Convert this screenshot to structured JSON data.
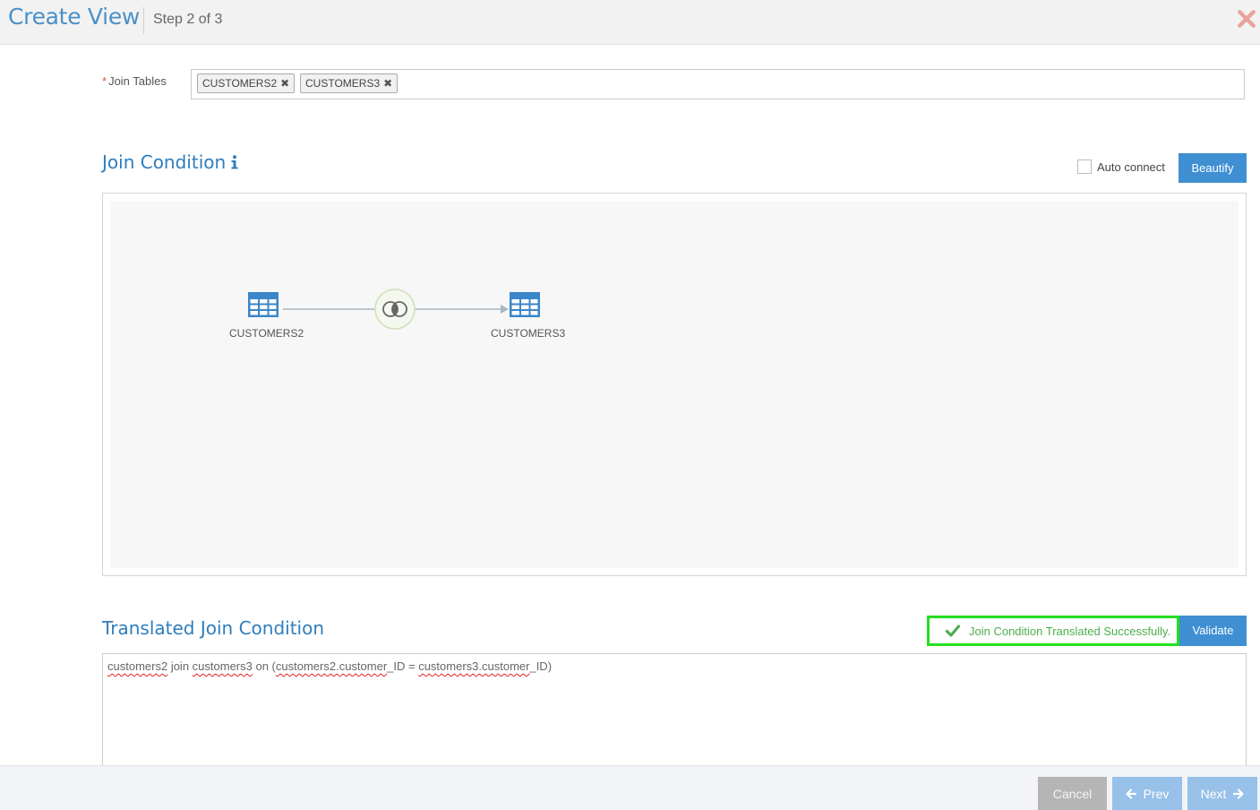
{
  "header": {
    "title": "Create View",
    "step": "Step 2 of 3",
    "close_icon": "close-icon"
  },
  "join_tables": {
    "required_marker": "*",
    "label": "Join Tables",
    "tags": [
      {
        "label": "CUSTOMERS2"
      },
      {
        "label": "CUSTOMERS3"
      }
    ]
  },
  "join_condition": {
    "title": "Join Condition",
    "info_icon": "info-icon",
    "auto_connect_label": "Auto connect",
    "auto_connect_checked": false,
    "beautify_label": "Beautify",
    "diagram": {
      "nodes": [
        {
          "label": "CUSTOMERS2",
          "icon": "table-icon"
        },
        {
          "label": "CUSTOMERS3",
          "icon": "table-icon"
        }
      ],
      "join_icon": "inner-join-icon"
    }
  },
  "translated": {
    "title": "Translated Join Condition",
    "status_text": "Join Condition Translated Successfully.",
    "status_color": "#4cae4c",
    "validate_label": "Validate",
    "sql_parts": [
      {
        "text": "customers2",
        "flag": true
      },
      {
        "text": " join ",
        "flag": false
      },
      {
        "text": "customers3",
        "flag": true
      },
      {
        "text": " on (",
        "flag": false
      },
      {
        "text": "customers2.customer",
        "flag": true
      },
      {
        "text": "_ID = ",
        "flag": false
      },
      {
        "text": "customers3.customer",
        "flag": true
      },
      {
        "text": "_ID)",
        "flag": false
      }
    ]
  },
  "footer": {
    "cancel_label": "Cancel",
    "prev_label": "Prev",
    "next_label": "Next"
  },
  "colors": {
    "accent": "#3f8fd2",
    "title": "#4a90c8",
    "highlight_border": "#22e01f",
    "close": "#e8a49a"
  }
}
